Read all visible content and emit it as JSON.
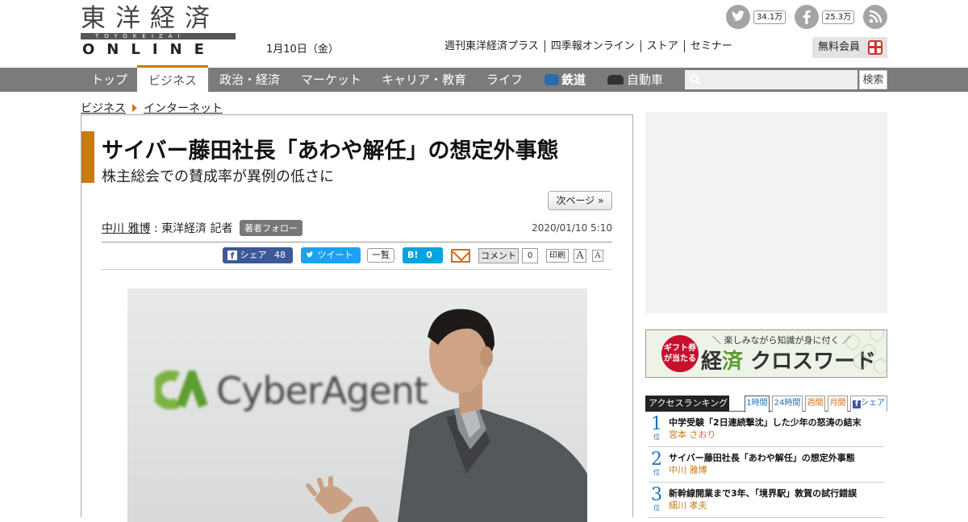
{
  "header": {
    "logo_kanji": "東洋経済",
    "logo_band": "TOYOKEIZAI",
    "logo_online": "ONLINE",
    "date": "1月10日（金）",
    "links": [
      "週刊東洋経済プラス",
      "四季報オンライン",
      "ストア",
      "セミナー"
    ],
    "member_button": "無料会員",
    "social": {
      "twitter_count": "34.1万",
      "facebook_count": "25.3万"
    }
  },
  "nav": {
    "items": [
      "トップ",
      "ビジネス",
      "政治・経済",
      "マーケット",
      "キャリア・教育",
      "ライフ",
      "鉄道",
      "自動車"
    ],
    "active_index": 1,
    "search_button": "検索",
    "search_placeholder": ""
  },
  "breadcrumb": [
    "ビジネス",
    "インターネット"
  ],
  "article": {
    "title": "サイバー藤田社長「あわや解任」の想定外事態",
    "subtitle": "株主総会での賛成率が異例の低さに",
    "next_page": "次ページ »",
    "author_name": "中川 雅博",
    "author_role": ": 東洋経済 記者",
    "follow_label": "著者フォロー",
    "published": "2020/01/10 5:10",
    "share": {
      "facebook_label": "シェア",
      "facebook_count": "48",
      "tweet_label": "ツイート",
      "list_label": "一覧",
      "hatena_label": "B!",
      "hatena_count": "0",
      "comment_label": "コメント",
      "comment_count": "0",
      "print_label": "印刷",
      "font_large": "A",
      "font_small": "A"
    },
    "photo_brand": "CyberAgent"
  },
  "sidebar": {
    "banner": {
      "badge": "ギフト券が当たる",
      "tagline": "＼ 楽しみながら知識が身に付く ／",
      "title_a": "経",
      "title_b": "済",
      "title_c": " クロスワード"
    },
    "ranking": {
      "title": "アクセスランキング",
      "tabs": [
        "1時間",
        "24時間",
        "週間",
        "月間",
        "シェア"
      ],
      "items": [
        {
          "rank": "1",
          "suffix": "位",
          "headline": "中学受験「2日連続撃沈」した少年の怒涛の結末",
          "author": "宮本 さおり"
        },
        {
          "rank": "2",
          "suffix": "位",
          "headline": "サイバー藤田社長「あわや解任」の想定外事態",
          "author": "中川 雅博"
        },
        {
          "rank": "3",
          "suffix": "位",
          "headline": "新幹線開業まで3年、「境界駅」敦賀の試行錯誤",
          "author": "細川 孝夫"
        }
      ]
    }
  }
}
